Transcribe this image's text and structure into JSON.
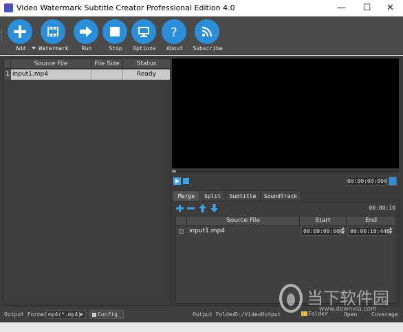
{
  "window": {
    "title": "Video Watermark Subtitle Creator Professional Edition 4.0",
    "minimize": "—",
    "maximize": "☐",
    "close": "✕"
  },
  "toolbar": {
    "items": [
      {
        "label": "Add",
        "icon": "plus-icon"
      },
      {
        "label": "Watermark",
        "icon": "film-icon"
      },
      {
        "label": "Run",
        "icon": "arrow-right-icon"
      },
      {
        "label": "Stop",
        "icon": "stop-icon"
      },
      {
        "label": "Options",
        "icon": "monitor-icon"
      },
      {
        "label": "About",
        "icon": "question-icon"
      },
      {
        "label": "Subscribe",
        "icon": "rss-icon"
      }
    ]
  },
  "file_table": {
    "columns": [
      "Source File",
      "File Size",
      "Status"
    ],
    "rows": [
      {
        "num": "1",
        "source": "input1.mp4",
        "size": "",
        "status": "Ready"
      }
    ]
  },
  "player": {
    "time": "00:00:00:000"
  },
  "tabs": [
    "Merge",
    "Split",
    "Subtitle",
    "Soundtrack"
  ],
  "merge": {
    "total_time": "00:00:10",
    "columns": [
      "Source File",
      "Start",
      "End"
    ],
    "rows": [
      {
        "source": "input1.mp4",
        "start": "00:00:00:000",
        "end": "00:00:10:446"
      }
    ]
  },
  "bottom": {
    "output_format_label": "Output Format",
    "output_format_value": "mp4(*.mp4)",
    "config_label": "Config",
    "output_folder_label": "Output Folder",
    "output_folder_value": "D:/VideoOutput",
    "folder_button": "Folder",
    "open_button": "Open",
    "coverage_label": "Coverage"
  },
  "watermark_logo": {
    "text": "当下软件园",
    "sub": "www.downxia.com"
  },
  "colors": {
    "accent": "#2b8ed8",
    "panel": "#3c3c3c",
    "toolbar": "#4a4a4a"
  }
}
